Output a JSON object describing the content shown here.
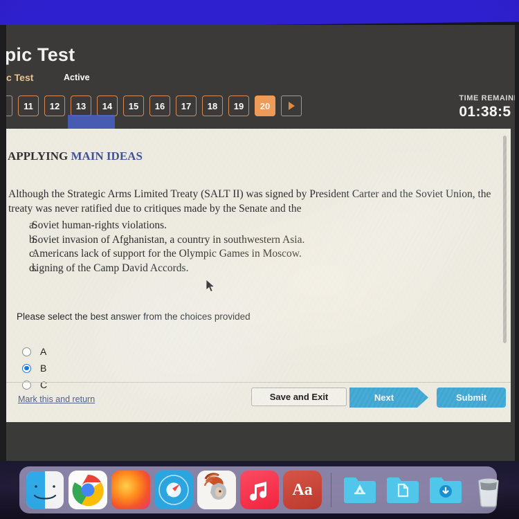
{
  "header": {
    "title": "opic Test",
    "breadcrumb": "opic Test",
    "status": "Active",
    "timer_label": "TIME REMAINING",
    "timer_value": "01:38:5"
  },
  "pager": {
    "prev_icon": "triangle-left-icon",
    "next_icon": "triangle-right-icon",
    "pages": [
      {
        "label": "11",
        "current": false
      },
      {
        "label": "12",
        "current": false
      },
      {
        "label": "13",
        "current": false
      },
      {
        "label": "14",
        "current": false
      },
      {
        "label": "15",
        "current": false
      },
      {
        "label": "16",
        "current": false
      },
      {
        "label": "17",
        "current": false
      },
      {
        "label": "18",
        "current": false
      },
      {
        "label": "19",
        "current": false
      },
      {
        "label": "20",
        "current": true
      }
    ]
  },
  "content": {
    "heading_plain": "APPLYING ",
    "heading_accent": "MAIN IDEAS",
    "question": "Although the Strategic Arms Limited Treaty (SALT II) was signed by President Carter and the Soviet Union, the treaty was never ratified due to critiques made by the Senate and the",
    "choices": [
      {
        "letter": "a.",
        "text": "Soviet human-rights violations."
      },
      {
        "letter": "b.",
        "text": "Soviet invasion of Afghanistan, a country in southwestern Asia."
      },
      {
        "letter": "c.",
        "text": "Americans lack of support for the Olympic Games in Moscow."
      },
      {
        "letter": "d.",
        "text": "signing of the Camp David Accords."
      }
    ],
    "prompt": "Please select the best answer from the choices provided",
    "answers": [
      {
        "label": "A",
        "selected": false
      },
      {
        "label": "B",
        "selected": true
      },
      {
        "label": "C",
        "selected": false
      }
    ]
  },
  "footer": {
    "mark_link": "Mark this and return",
    "save_exit": "Save and Exit",
    "next": "Next",
    "submit": "Submit"
  },
  "dock": {
    "items": [
      {
        "name": "finder-icon",
        "kind": "finder",
        "running": true
      },
      {
        "name": "chrome-icon",
        "kind": "chrome",
        "running": true
      },
      {
        "name": "firefox-icon",
        "kind": "firefox",
        "running": true
      },
      {
        "name": "safari-icon",
        "kind": "safari",
        "running": false
      },
      {
        "name": "trojan-helmet-icon",
        "kind": "trojan",
        "running": false
      },
      {
        "name": "music-icon",
        "kind": "music",
        "running": false
      },
      {
        "name": "dictionary-icon",
        "kind": "dict",
        "running": true,
        "glyph": "Aa"
      },
      {
        "name": "applications-folder-icon",
        "kind": "folder-apps",
        "running": false
      },
      {
        "name": "documents-folder-icon",
        "kind": "folder-documents",
        "running": false
      },
      {
        "name": "downloads-folder-icon",
        "kind": "folder-downloads",
        "running": false
      },
      {
        "name": "trash-icon",
        "kind": "trash",
        "running": false
      }
    ]
  },
  "colors": {
    "accent_orange": "#ef9b58",
    "accent_blue": "#3fa7d2",
    "radio_selected": "#1574dd",
    "heading_blue": "#3b4f8f",
    "top_band": "#2f20cf"
  }
}
